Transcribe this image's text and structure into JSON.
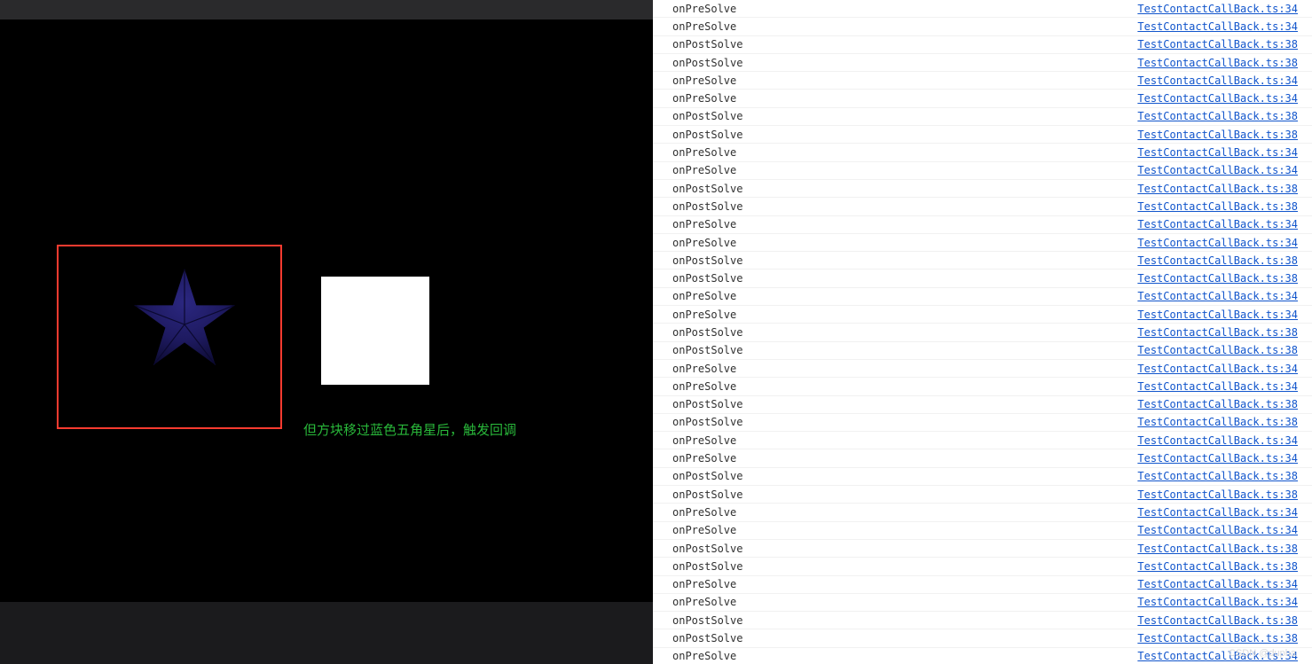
{
  "game": {
    "annotation": "但方块移过蓝色五角星后，触发回调",
    "star_color_top": "#2a2678",
    "star_color_bottom": "#17144a",
    "selection_color": "#ff3b30"
  },
  "watermark": "CSDN @dupha",
  "console": {
    "source_file": "TestContactCallBack.ts",
    "logs": [
      {
        "msg": "onPreSolve",
        "line": 34
      },
      {
        "msg": "onPreSolve",
        "line": 34
      },
      {
        "msg": "onPostSolve",
        "line": 38
      },
      {
        "msg": "onPostSolve",
        "line": 38
      },
      {
        "msg": "onPreSolve",
        "line": 34
      },
      {
        "msg": "onPreSolve",
        "line": 34
      },
      {
        "msg": "onPostSolve",
        "line": 38
      },
      {
        "msg": "onPostSolve",
        "line": 38
      },
      {
        "msg": "onPreSolve",
        "line": 34
      },
      {
        "msg": "onPreSolve",
        "line": 34
      },
      {
        "msg": "onPostSolve",
        "line": 38
      },
      {
        "msg": "onPostSolve",
        "line": 38
      },
      {
        "msg": "onPreSolve",
        "line": 34
      },
      {
        "msg": "onPreSolve",
        "line": 34
      },
      {
        "msg": "onPostSolve",
        "line": 38
      },
      {
        "msg": "onPostSolve",
        "line": 38
      },
      {
        "msg": "onPreSolve",
        "line": 34
      },
      {
        "msg": "onPreSolve",
        "line": 34
      },
      {
        "msg": "onPostSolve",
        "line": 38
      },
      {
        "msg": "onPostSolve",
        "line": 38
      },
      {
        "msg": "onPreSolve",
        "line": 34
      },
      {
        "msg": "onPreSolve",
        "line": 34
      },
      {
        "msg": "onPostSolve",
        "line": 38
      },
      {
        "msg": "onPostSolve",
        "line": 38
      },
      {
        "msg": "onPreSolve",
        "line": 34
      },
      {
        "msg": "onPreSolve",
        "line": 34
      },
      {
        "msg": "onPostSolve",
        "line": 38
      },
      {
        "msg": "onPostSolve",
        "line": 38
      },
      {
        "msg": "onPreSolve",
        "line": 34
      },
      {
        "msg": "onPreSolve",
        "line": 34
      },
      {
        "msg": "onPostSolve",
        "line": 38
      },
      {
        "msg": "onPostSolve",
        "line": 38
      },
      {
        "msg": "onPreSolve",
        "line": 34
      },
      {
        "msg": "onPreSolve",
        "line": 34
      },
      {
        "msg": "onPostSolve",
        "line": 38
      },
      {
        "msg": "onPostSolve",
        "line": 38
      },
      {
        "msg": "onPreSolve",
        "line": 34
      }
    ]
  }
}
